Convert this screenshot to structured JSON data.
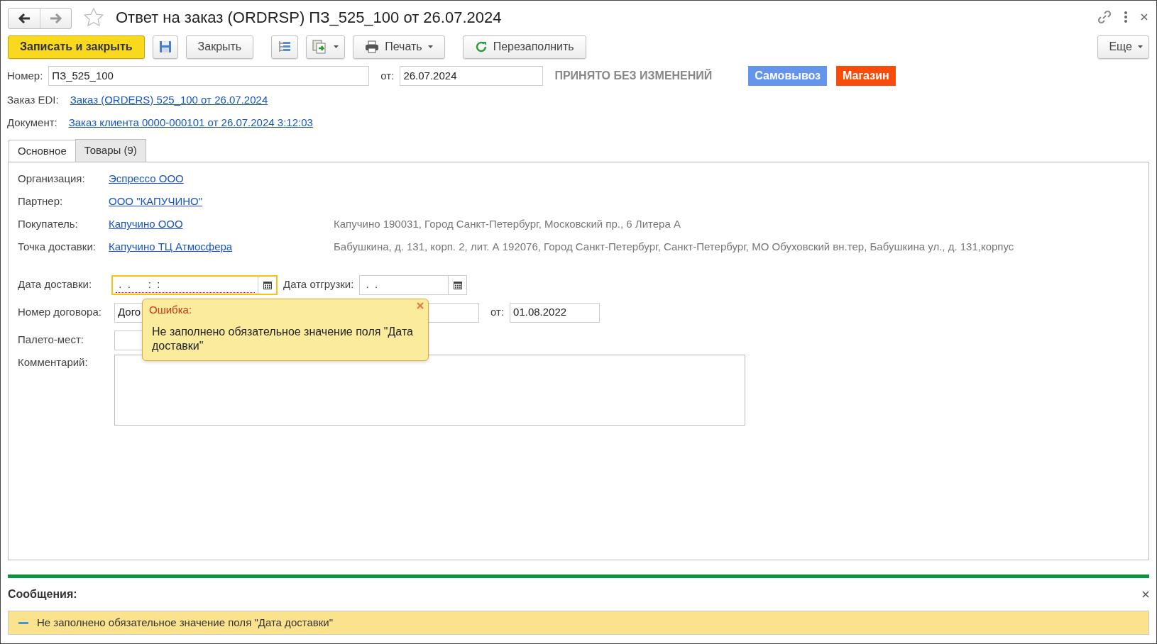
{
  "window": {
    "title": "Ответ на заказ (ORDRSP) ПЗ_525_100 от 26.07.2024",
    "favorite": false
  },
  "toolbar": [
    {
      "kind": "primary",
      "label": "Записать и закрыть"
    },
    {
      "kind": "save"
    },
    {
      "kind": "text",
      "label": "Закрыть"
    },
    {
      "kind": "structure"
    },
    {
      "kind": "related"
    },
    {
      "kind": "print",
      "label": "Печать"
    },
    {
      "kind": "refill",
      "label": "Перезаполнить"
    },
    {
      "kind": "more",
      "label": "Еще"
    }
  ],
  "header": {
    "number_label": "Номер:",
    "number": "ПЗ_525_100",
    "date_label": "от:",
    "date": "26.07.2024",
    "status": "ПРИНЯТО БЕЗ ИЗМЕНЕНИЙ",
    "tags": [
      {
        "label": "Самовывоз",
        "color": "#6495ed"
      },
      {
        "label": "Магазин",
        "color": "#f84c0b"
      }
    ]
  },
  "links": [
    {
      "label": "Заказ EDI:",
      "link": "Заказ (ORDERS) 525_100 от 26.07.2024"
    },
    {
      "label": "Документ:",
      "link": "Заказ клиента 0000-000101 от 26.07.2024 3:12:03"
    }
  ],
  "tabs": [
    {
      "label": "Основное",
      "selected": true
    },
    {
      "label": "Товары (9)",
      "selected": false
    }
  ],
  "parties": [
    {
      "label": "Организация:",
      "link": "Эспрессо ООО"
    },
    {
      "label": "Партнер:",
      "link": "ООО \"КАПУЧИНО\""
    },
    {
      "label": "Покупатель:",
      "link": "Капучино ООО",
      "address": "Капучино 190031, Город Санкт-Петербург, Московский пр., 6 Литера А"
    },
    {
      "label": "Точка доставки:",
      "link": "Капучино ТЦ Атмосфера",
      "address": "Бабушкина, д. 131, корп. 2, лит. А 192076, Город Санкт-Петербург, Санкт-Петербург, МО Обуховский вн.тер, Бабушкина ул., д. 131,корпус"
    }
  ],
  "delivery_date": {
    "label": "Дата доставки:",
    "value": " .  .      :  :",
    "error": true
  },
  "shipment_date": {
    "label": "Дата отгрузки:",
    "value": " .  .",
    "error": false
  },
  "contract": {
    "label": "Номер договора:",
    "value": "Дого",
    "date_label": "от:",
    "date": "01.08.2022"
  },
  "pallets": {
    "label": "Палето-мест:"
  },
  "comment": {
    "label": "Комментарий:"
  },
  "tooltip": {
    "title": "Ошибка:",
    "text": "Не заполнено обязательное значение поля \"Дата доставки\""
  },
  "messages": {
    "title": "Сообщения:",
    "items": [
      "Не заполнено обязательное значение поля \"Дата доставки\""
    ]
  }
}
